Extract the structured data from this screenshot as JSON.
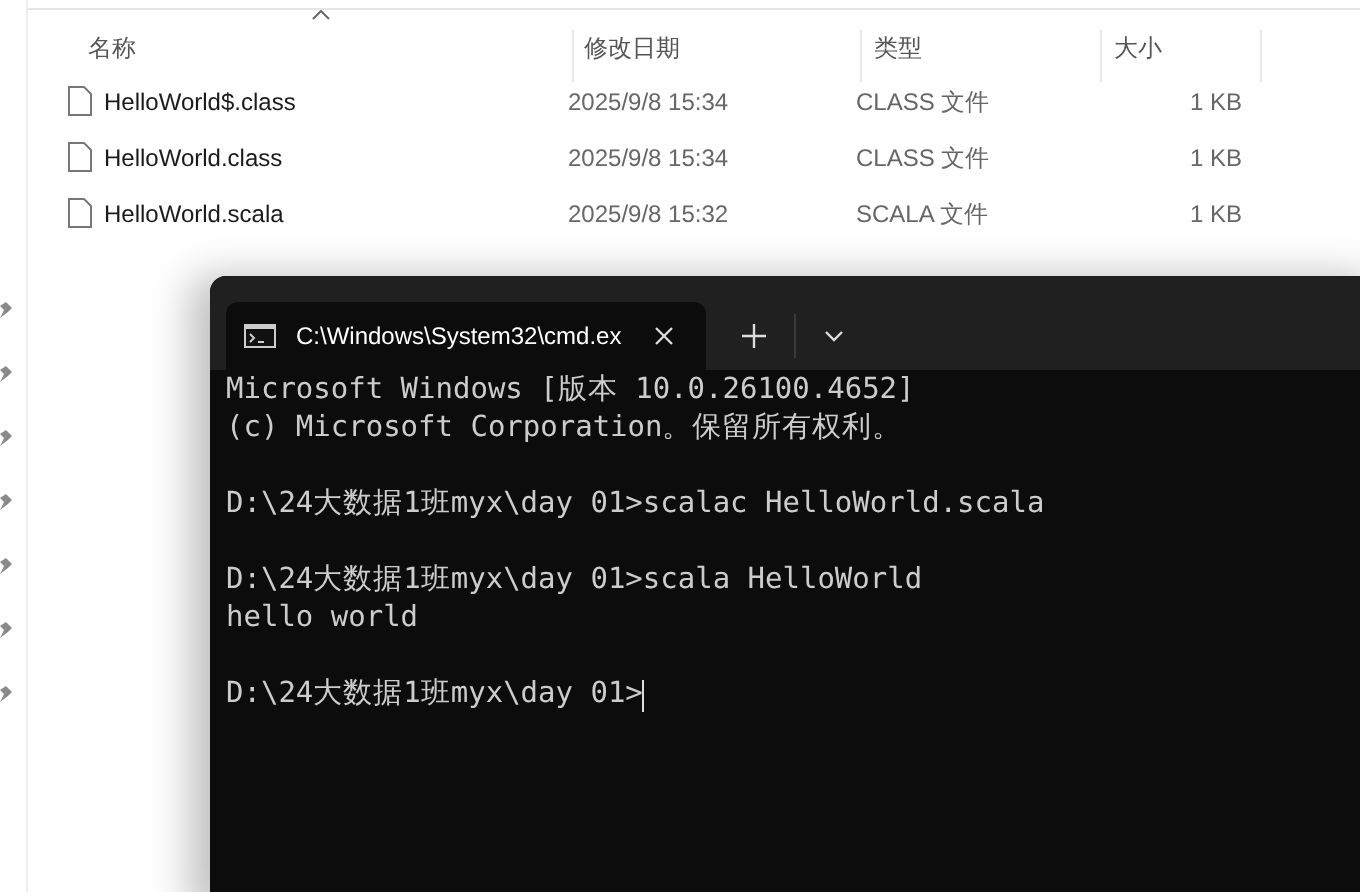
{
  "explorer": {
    "columns": [
      "名称",
      "修改日期",
      "类型",
      "大小"
    ],
    "files": [
      {
        "name": "HelloWorld$.class",
        "modified": "2025/9/8 15:34",
        "type": "CLASS 文件",
        "size": "1 KB"
      },
      {
        "name": "HelloWorld.class",
        "modified": "2025/9/8 15:34",
        "type": "CLASS 文件",
        "size": "1 KB"
      },
      {
        "name": "HelloWorld.scala",
        "modified": "2025/9/8 15:32",
        "type": "SCALA 文件",
        "size": "1 KB"
      }
    ]
  },
  "terminal": {
    "tab": {
      "title": "C:\\Windows\\System32\\cmd.ex",
      "selected": true
    },
    "blocks": [
      [
        "Microsoft Windows [版本 10.0.26100.4652]",
        "(c) Microsoft Corporation。保留所有权利。"
      ],
      [
        "D:\\24大数据1班myx\\day 01>scalac HelloWorld.scala"
      ],
      [
        "D:\\24大数据1班myx\\day 01>scala HelloWorld",
        "hello world"
      ],
      [
        "D:\\24大数据1班myx\\day 01>"
      ]
    ],
    "cursor": true
  }
}
